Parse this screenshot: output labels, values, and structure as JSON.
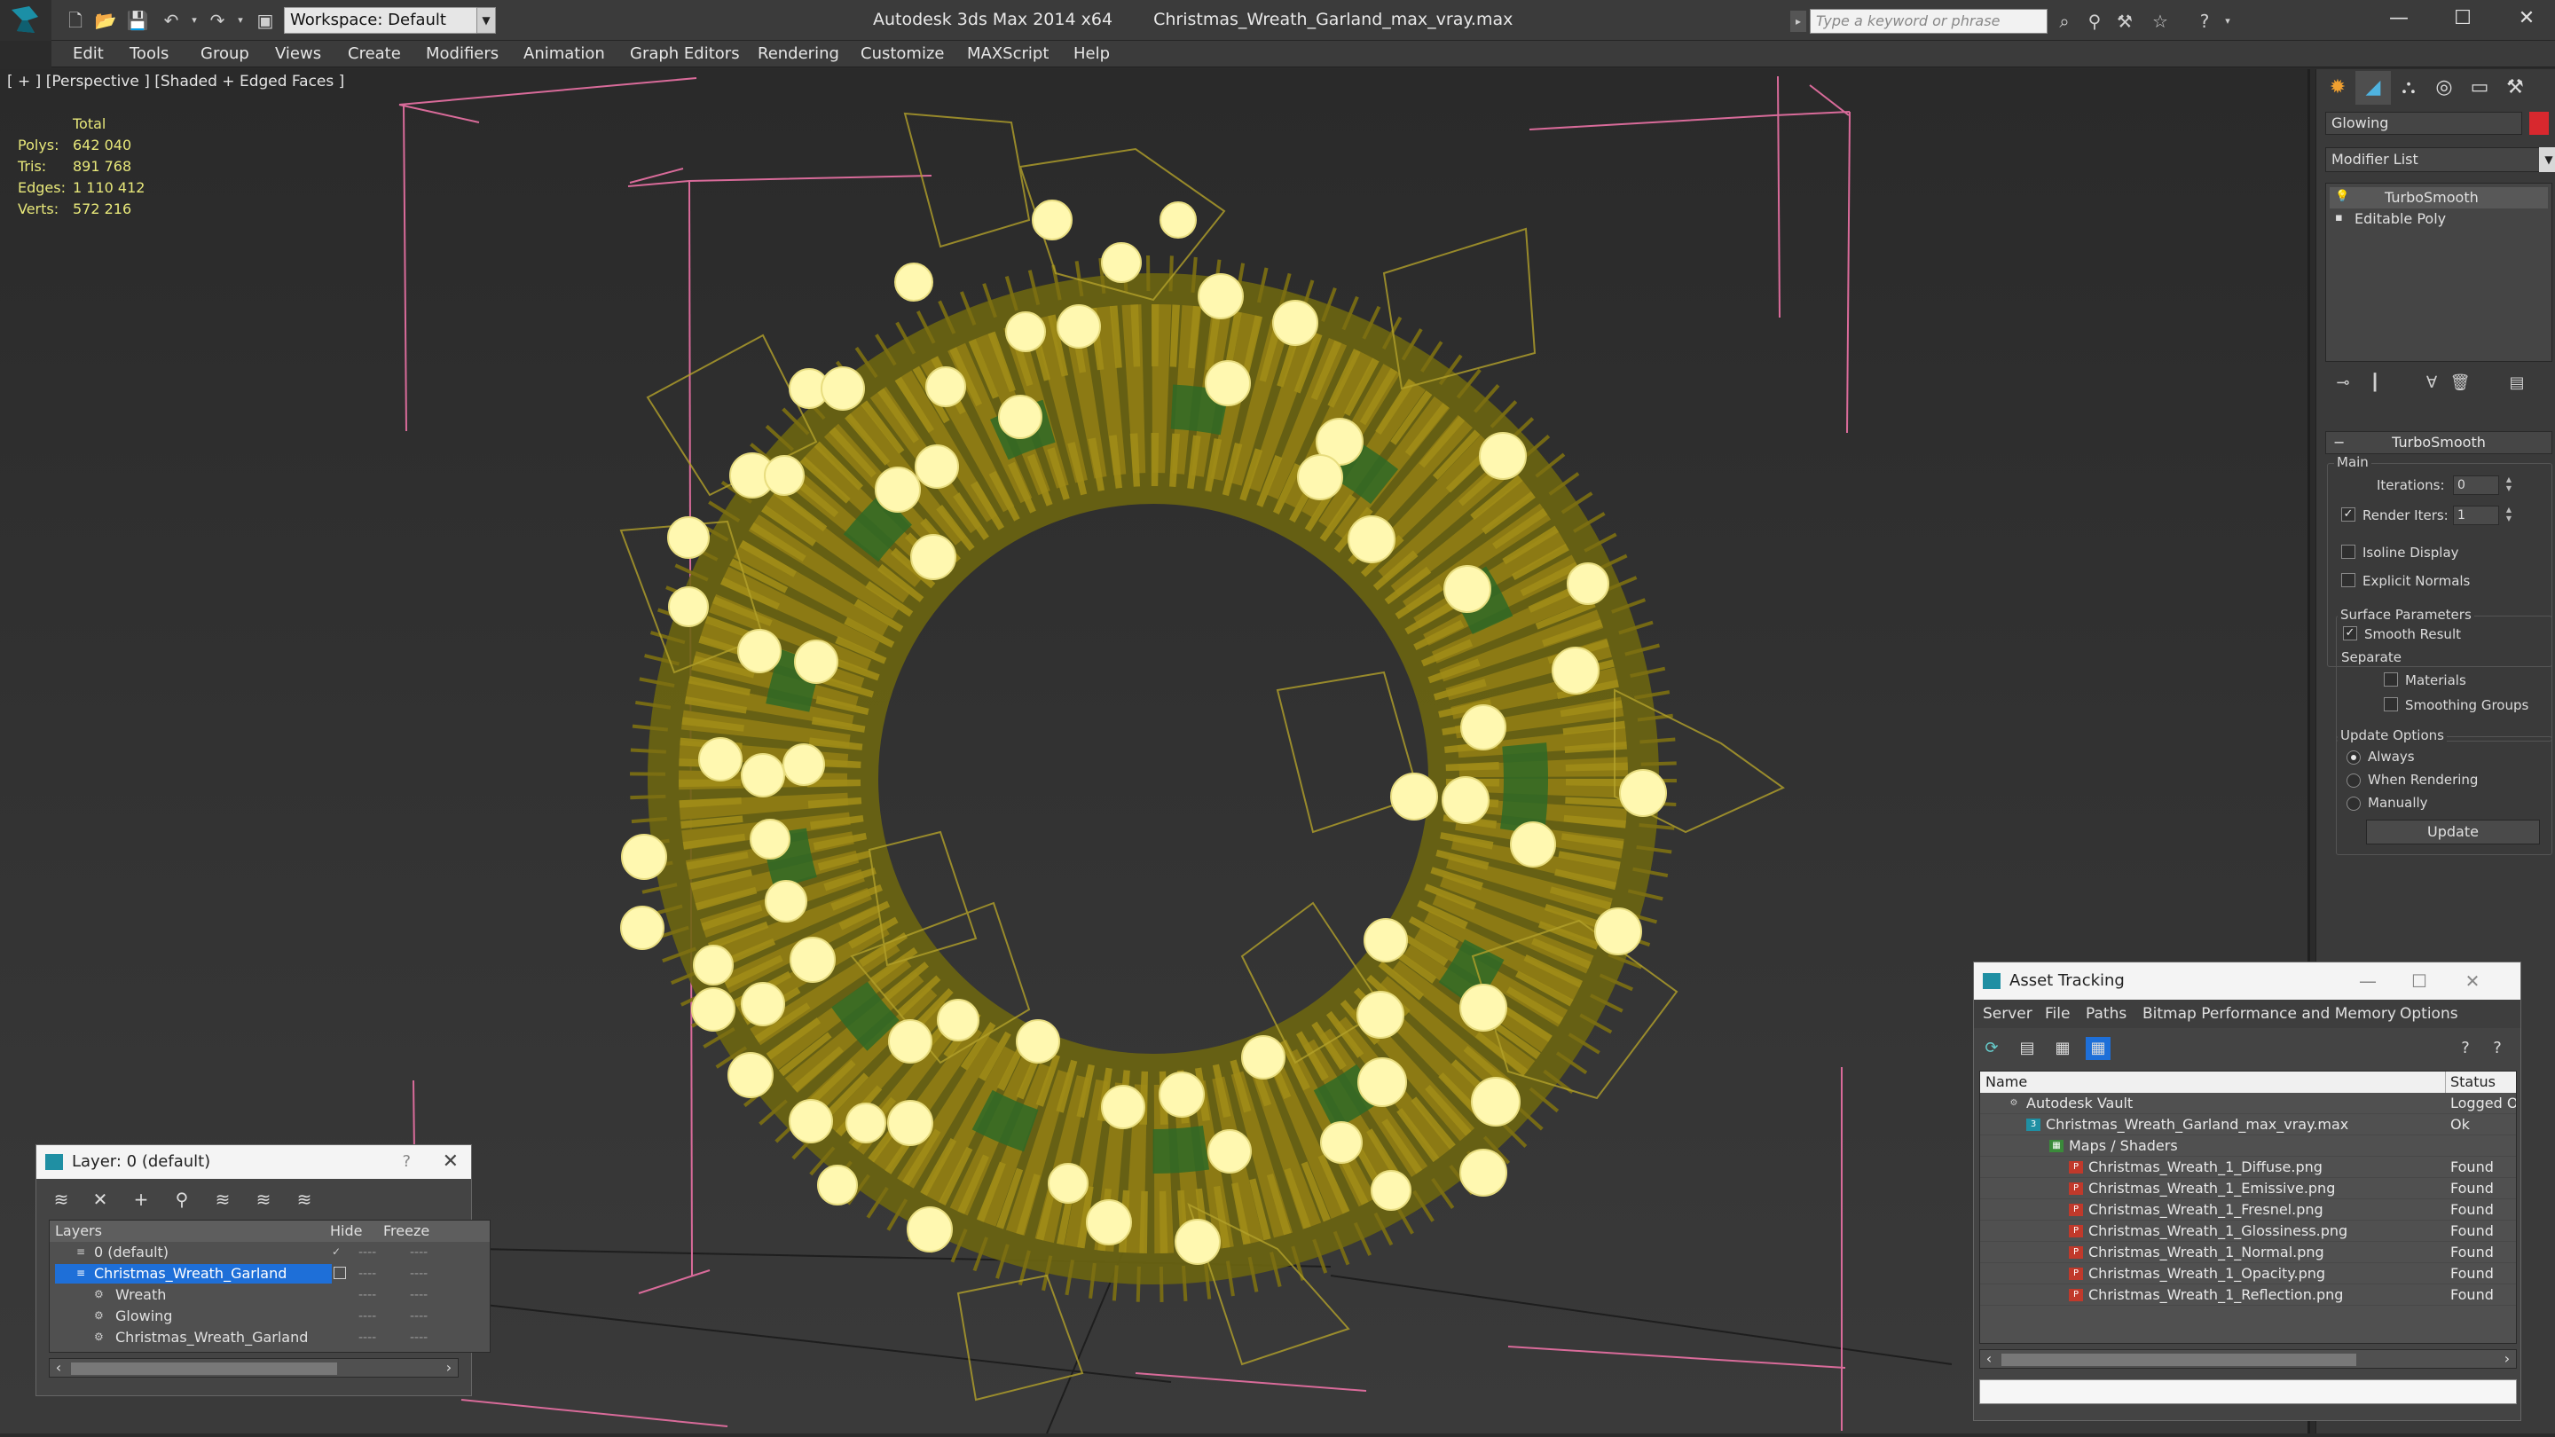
{
  "titlebar": {
    "workspace_label": "Workspace: Default",
    "app_title": "Autodesk 3ds Max  2014 x64",
    "file_name": "Christmas_Wreath_Garland_max_vray.max",
    "search_placeholder": "Type a keyword or phrase",
    "window_buttons": [
      "—",
      "☐",
      "✕"
    ]
  },
  "menubar": {
    "items": [
      "Edit",
      "Tools",
      "Group",
      "Views",
      "Create",
      "Modifiers",
      "Animation",
      "Graph Editors",
      "Rendering",
      "Customize",
      "MAXScript",
      "Help"
    ]
  },
  "viewport": {
    "label": "[ + ] [Perspective ] [Shaded + Edged Faces ]",
    "stats": {
      "header": "Total",
      "rows": [
        {
          "label": "Polys:",
          "value": "642 040"
        },
        {
          "label": "Tris:",
          "value": "891 768"
        },
        {
          "label": "Edges:",
          "value": "1 110 412"
        },
        {
          "label": "Verts:",
          "value": "572 216"
        }
      ]
    }
  },
  "command_panel": {
    "object_name": "Glowing",
    "object_color": "#d8282e",
    "modifier_list": "Modifier List",
    "stack": [
      "TurboSmooth",
      "Editable Poly"
    ],
    "rollout_title": "TurboSmooth",
    "main_group": "Main",
    "iterations_label": "Iterations:",
    "iterations_value": "0",
    "render_iters_label": "Render Iters:",
    "render_iters_value": "1",
    "isoline_label": "Isoline Display",
    "explicit_normals_label": "Explicit Normals",
    "surface_group": "Surface Parameters",
    "smooth_result_label": "Smooth Result",
    "separate_label": "Separate",
    "materials_label": "Materials",
    "smoothing_groups_label": "Smoothing Groups",
    "update_group": "Update Options",
    "always_label": "Always",
    "when_rendering_label": "When Rendering",
    "manually_label": "Manually",
    "update_button": "Update"
  },
  "layer_dialog": {
    "title": "Layer: 0 (default)",
    "help": "?",
    "columns": {
      "layers": "Layers",
      "hide": "Hide",
      "freeze": "Freeze"
    },
    "rows": [
      {
        "name": "0 (default)"
      },
      {
        "name": "Christmas_Wreath_Garland"
      },
      {
        "name": "Wreath"
      },
      {
        "name": "Glowing"
      },
      {
        "name": "Christmas_Wreath_Garland"
      }
    ],
    "dash": "----"
  },
  "asset_dialog": {
    "title": "Asset Tracking",
    "menu": [
      "Server",
      "File",
      "Paths",
      "Bitmap Performance and Memory",
      "Options"
    ],
    "columns": {
      "name": "Name",
      "status": "Status"
    },
    "rows": [
      {
        "name": "Autodesk Vault",
        "status": "Logged O"
      },
      {
        "name": "Christmas_Wreath_Garland_max_vray.max",
        "status": "Ok"
      },
      {
        "name": "Maps / Shaders",
        "status": ""
      },
      {
        "name": "Christmas_Wreath_1_Diffuse.png",
        "status": "Found"
      },
      {
        "name": "Christmas_Wreath_1_Emissive.png",
        "status": "Found"
      },
      {
        "name": "Christmas_Wreath_1_Fresnel.png",
        "status": "Found"
      },
      {
        "name": "Christmas_Wreath_1_Glossiness.png",
        "status": "Found"
      },
      {
        "name": "Christmas_Wreath_1_Normal.png",
        "status": "Found"
      },
      {
        "name": "Christmas_Wreath_1_Opacity.png",
        "status": "Found"
      },
      {
        "name": "Christmas_Wreath_1_Reflection.png",
        "status": "Found"
      }
    ]
  }
}
